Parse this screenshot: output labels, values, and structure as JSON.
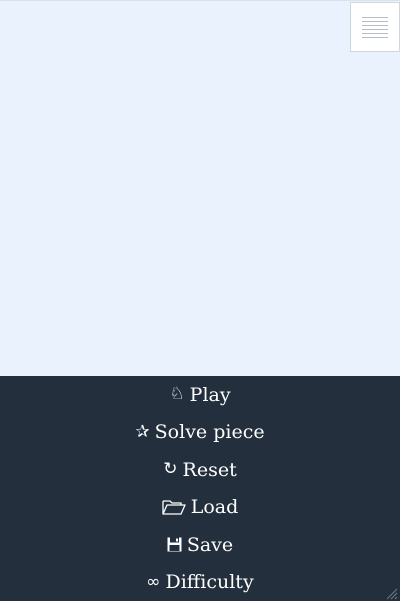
{
  "menu": {
    "items": [
      {
        "icon": "knight-icon",
        "glyph": "♘",
        "label": "Play"
      },
      {
        "icon": "star-icon",
        "glyph": "✰",
        "label": "Solve piece"
      },
      {
        "icon": "reset-icon",
        "glyph": "↻",
        "label": "Reset"
      },
      {
        "icon": "folder-open-icon",
        "glyph": "",
        "label": "Load"
      },
      {
        "icon": "floppy-disk-icon",
        "glyph": "",
        "label": "Save"
      },
      {
        "icon": "infinity-icon",
        "glyph": "∞",
        "label": "Difficulty"
      }
    ]
  },
  "colors": {
    "board_background": "#eaf3fd",
    "menu_background": "#232f3d",
    "menu_text": "#ffffff"
  }
}
